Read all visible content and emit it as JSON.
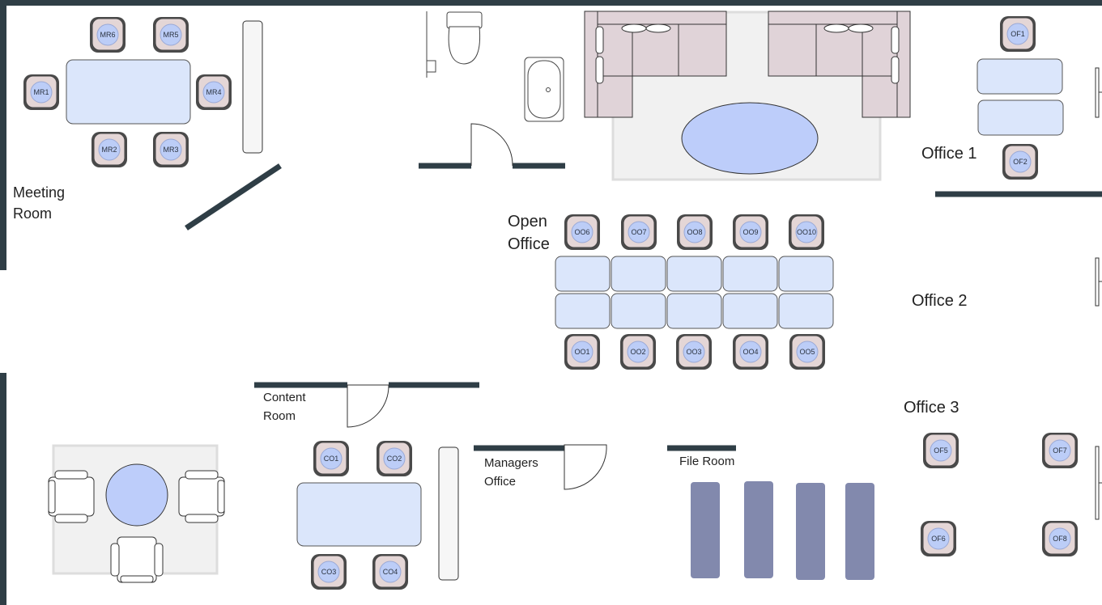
{
  "rooms": {
    "meeting_room": "Meeting\nRoom",
    "open_office": "Open\nOffice",
    "office_1": "Office 1",
    "office_2": "Office 2",
    "office_3": "Office 3",
    "content_room": "Content\nRoom",
    "managers_office": "Managers\nOffice",
    "file_room": "File Room"
  },
  "seats": {
    "meeting_room": [
      "MR1",
      "MR2",
      "MR3",
      "MR4",
      "MR5",
      "MR6"
    ],
    "open_office": [
      "OO1",
      "OO2",
      "OO3",
      "OO4",
      "OO5",
      "OO6",
      "OO7",
      "OO8",
      "OO9",
      "OO10"
    ],
    "offices": [
      "OF1",
      "OF2",
      "OF5",
      "OF6",
      "OF7",
      "OF8"
    ],
    "content_room": [
      "CO1",
      "CO2",
      "CO3",
      "CO4"
    ]
  },
  "colors": {
    "wall": "#2f3e46",
    "desk_fill": "#dbe6fb",
    "chair_fill": "#e4d6d6",
    "seat_marker": "#bccdf7",
    "sofa_fill": "#e0d3d8",
    "cabinet_fill": "#8289ad",
    "rug_fill": "#f1f1f1",
    "round_table": "#bdcdfa"
  }
}
